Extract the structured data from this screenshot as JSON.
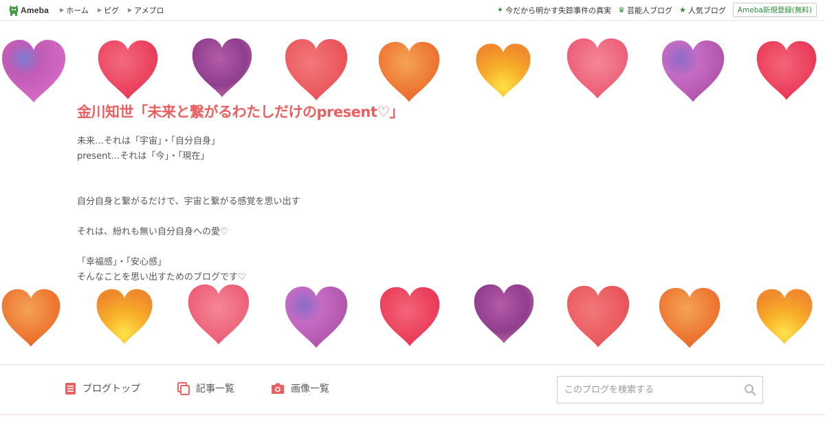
{
  "topbar": {
    "logo_text": "Ameba",
    "nav": [
      {
        "label": "ホーム"
      },
      {
        "label": "ピグ"
      },
      {
        "label": "アメブロ"
      }
    ],
    "right_links": [
      {
        "label": "今だから明かす失踪事件の真実",
        "icon": "sparkle-icon"
      },
      {
        "label": "芸能人ブログ",
        "icon": "crown-icon"
      },
      {
        "label": "人気ブログ",
        "icon": "star-icon"
      }
    ],
    "register_label": "Ameba新規登録(無料)"
  },
  "blog": {
    "title": "金川知世「未来と繋がるわたしだけのpresent♡」",
    "description": "未来…それは「宇宙」・「自分自身」\npresent…それは「今」・「現在」\n\n\n自分自身と繋がるだけで、宇宙と繋がる感覚を思い出す\n\nそれは、紛れも無い自分自身への愛♡\n\n「幸福感」・「安心感」\nそんなことを思い出すためのブログです♡"
  },
  "subnav": {
    "items": [
      {
        "label": "ブログトップ",
        "icon": "blog-top-icon"
      },
      {
        "label": "記事一覧",
        "icon": "article-list-icon"
      },
      {
        "label": "画像一覧",
        "icon": "camera-icon"
      }
    ],
    "search_placeholder": "このブログを検索する"
  },
  "colors": {
    "accent": "#e8605f",
    "ameba_green": "#2d8c3c",
    "heart_palette": [
      "#c45bb0",
      "#e9455a",
      "#9b4a9c",
      "#ec5d5c",
      "#ef8a3c",
      "#f7a42b",
      "#e9627a",
      "#b65fb5",
      "#ee4257"
    ]
  }
}
